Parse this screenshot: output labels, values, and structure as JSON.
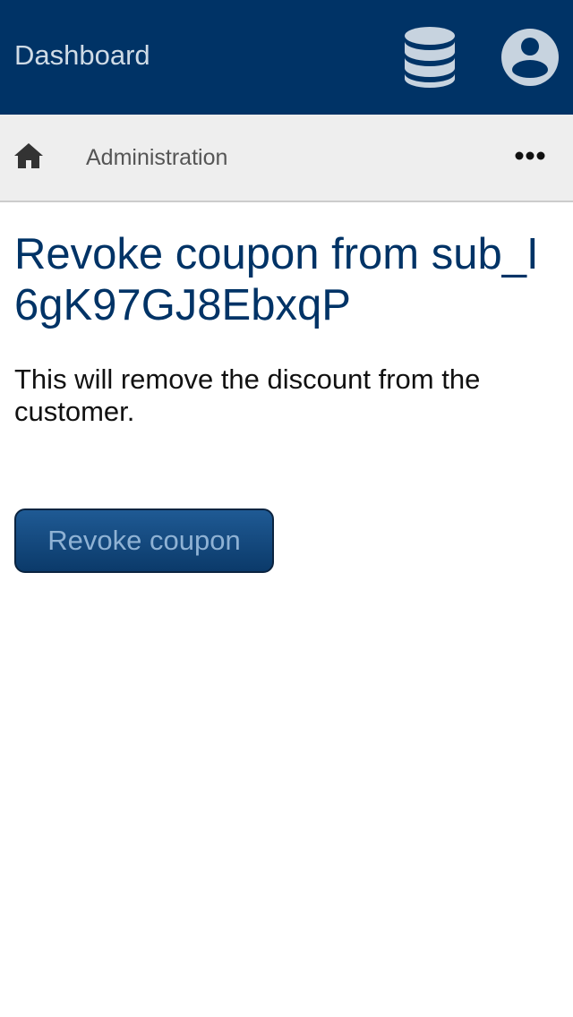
{
  "header": {
    "app_title": "Dashboard",
    "database_icon": "database-icon",
    "user_icon": "user-account-icon"
  },
  "breadcrumb": {
    "home_icon": "home-icon",
    "label": "Administration",
    "more_icon": "more-horizontal-icon"
  },
  "main": {
    "title": "Revoke coupon from sub_I6gK97GJ8EbxqP",
    "description": "This will remove the discount from the customer.",
    "revoke_button_label": "Revoke coupon"
  },
  "colors": {
    "header_bg": "#003366",
    "subbar_bg": "#eeeeee",
    "title": "#003366",
    "button_bg": "#1f5a94"
  }
}
